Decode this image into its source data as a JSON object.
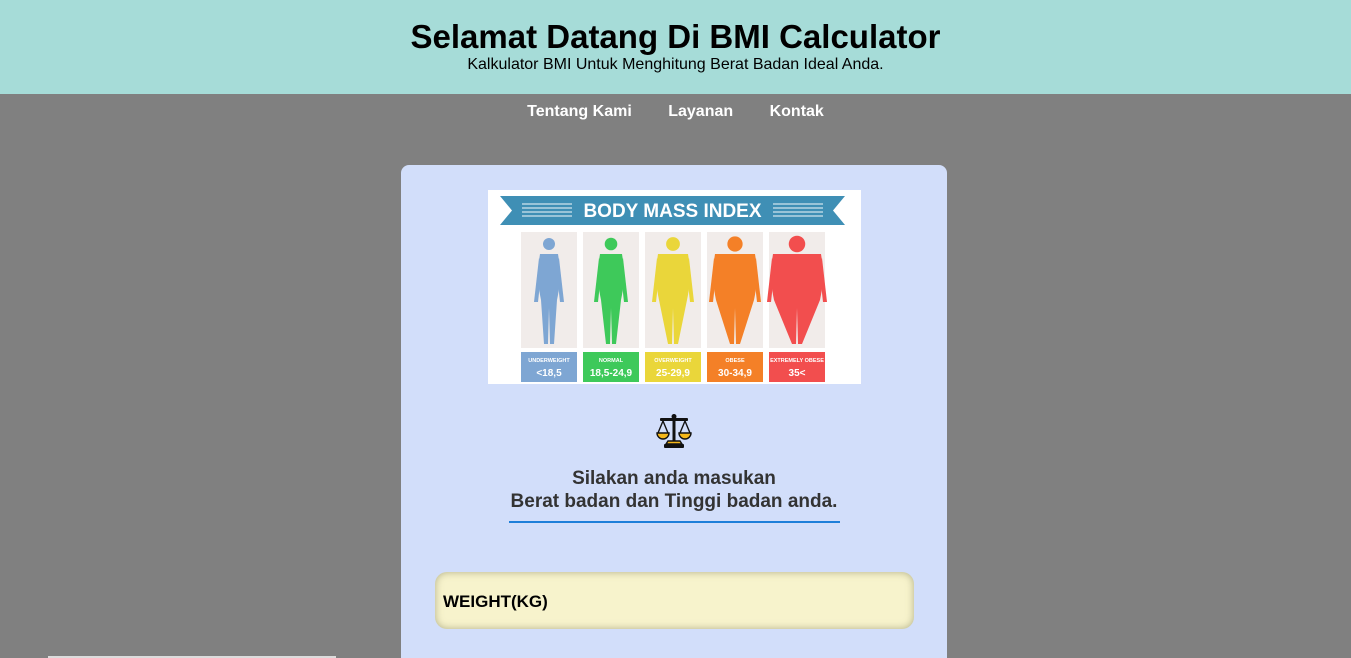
{
  "header": {
    "title": "Selamat Datang Di BMI Calculator",
    "subtitle": "Kalkulator BMI Untuk Menghitung Berat Badan Ideal Anda."
  },
  "nav": {
    "items": [
      {
        "label": "Tentang Kami"
      },
      {
        "label": "Layanan"
      },
      {
        "label": "Kontak"
      }
    ]
  },
  "bmi_image": {
    "banner_text": "BODY MASS INDEX",
    "categories": [
      {
        "name": "UNDERWEIGHT",
        "range": "<18,5",
        "color": "#7ea6d3"
      },
      {
        "name": "NORMAL",
        "range": "18,5-24,9",
        "color": "#3ec95a"
      },
      {
        "name": "OVERWEIGHT",
        "range": "25-29,9",
        "color": "#ead63a"
      },
      {
        "name": "OBESE",
        "range": "30-34,9",
        "color": "#f48027"
      },
      {
        "name": "EXTREMELY OBESE",
        "range": "35<",
        "color": "#f24e4e"
      }
    ]
  },
  "prompt": {
    "line1": "Silakan anda masukan",
    "line2": "Berat badan dan Tinggi badan anda."
  },
  "form": {
    "weight_label": "WEIGHT(KG)"
  },
  "colors": {
    "header_bg": "#a6dcd8",
    "page_bg": "#808080",
    "card_bg": "#d2defa",
    "accent": "#1e7fd9",
    "input_bg": "#f7f3cc"
  },
  "icons": {
    "scale": "scale-balance-icon"
  }
}
